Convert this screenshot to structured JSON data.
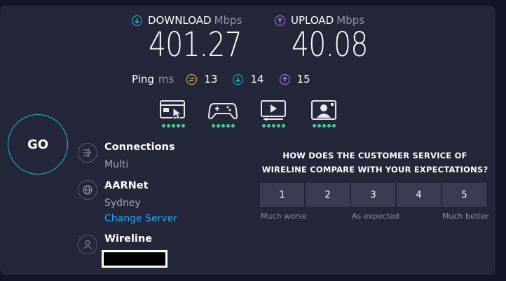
{
  "download": {
    "label": "DOWNLOAD",
    "unit": "Mbps",
    "value": "401.27",
    "color": "#19c0d8"
  },
  "upload": {
    "label": "UPLOAD",
    "unit": "Mbps",
    "value": "40.08",
    "color": "#b27cf5"
  },
  "ping": {
    "label": "Ping",
    "unit": "ms",
    "idle": {
      "value": "13",
      "color": "#e6c84a"
    },
    "download": {
      "value": "14",
      "color": "#19c0d8"
    },
    "upload": {
      "value": "15",
      "color": "#b27cf5"
    }
  },
  "usecases": [
    {
      "icon": "web-browsing-icon",
      "rating": 5
    },
    {
      "icon": "gaming-icon",
      "rating": 5
    },
    {
      "icon": "video-streaming-icon",
      "rating": 5
    },
    {
      "icon": "video-chat-icon",
      "rating": 5
    }
  ],
  "go_button": "GO",
  "connections": {
    "title": "Connections",
    "value": "Multi"
  },
  "server": {
    "title": "AARNet",
    "location": "Sydney",
    "change_link": "Change Server"
  },
  "provider": {
    "title": "Wireline"
  },
  "survey": {
    "question": "HOW DOES THE CUSTOMER SERVICE OF WIRELINE COMPARE WITH YOUR EXPECTATIONS?",
    "options": [
      "1",
      "2",
      "3",
      "4",
      "5"
    ],
    "low_label": "Much worse",
    "mid_label": "As expected",
    "high_label": "Much better"
  }
}
